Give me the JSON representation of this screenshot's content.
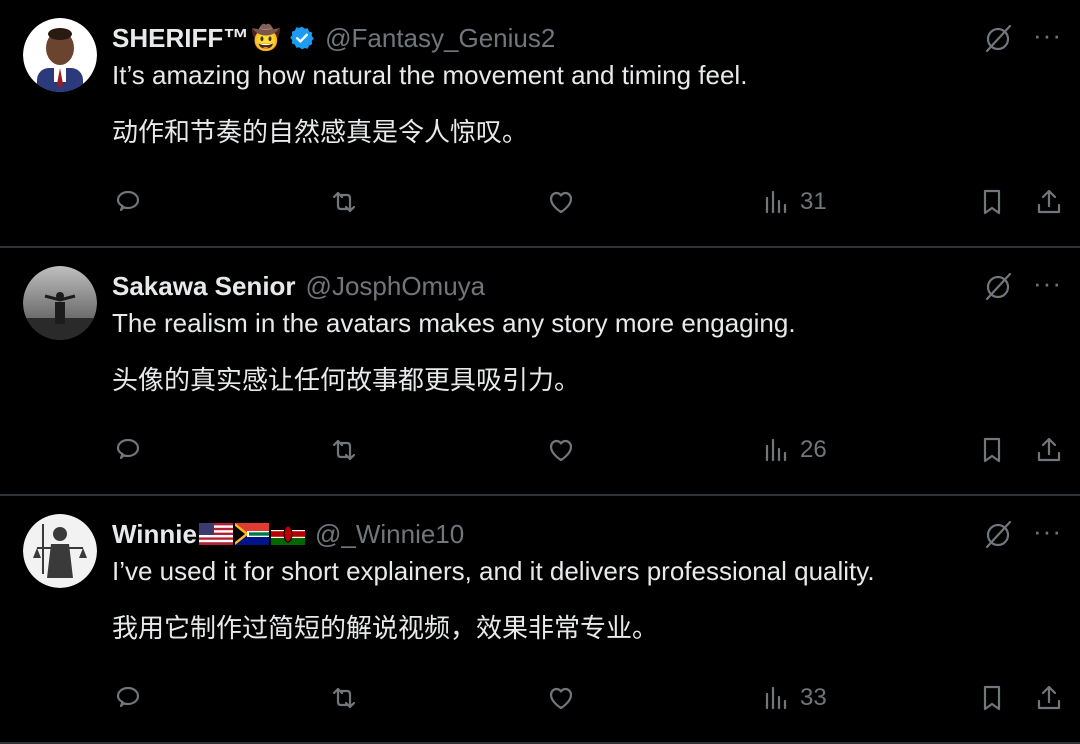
{
  "tweets": [
    {
      "display_name": "SHERIFF™",
      "emoji": "🤠",
      "verified": true,
      "handle": "@Fantasy_Genius2",
      "text_en": "It’s amazing how natural the movement and timing feel.",
      "text_zh": "动作和节奏的自然感真是令人惊叹。",
      "views": "31",
      "avatar": "portrait-man-suit"
    },
    {
      "display_name": "Sakawa Senior",
      "handle": "@JosphOmuya",
      "text_en": "The realism in the avatars makes any story more engaging.",
      "text_zh": "头像的真实感让任何故事都更具吸引力。",
      "views": "26",
      "avatar": "statue-grayscale"
    },
    {
      "display_name": "Winnie",
      "flags": [
        "us-flag-icon",
        "south-africa-flag-icon",
        "kenya-flag-icon"
      ],
      "handle": "@_Winnie10",
      "text_en": "I’ve used it for short explainers, and it delivers professional quality.",
      "text_zh": "我用它制作过简短的解说视频，效果非常专业。",
      "views": "33",
      "avatar": "lady-justice"
    }
  ],
  "colors": {
    "background": "#000000",
    "text": "#e7e9ea",
    "muted": "#71767b",
    "divider": "#2f3336",
    "verified": "#1d9bf0"
  },
  "more_label": "···"
}
